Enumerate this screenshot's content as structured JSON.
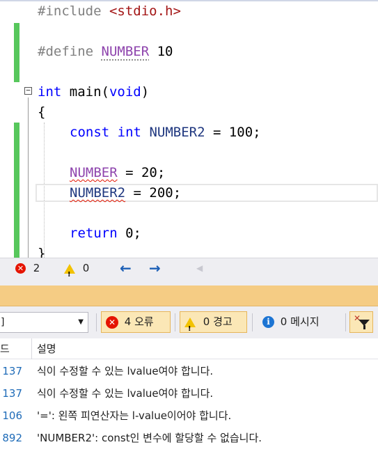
{
  "editor": {
    "lines": [
      {
        "id": "l1",
        "tokens": [
          {
            "t": "#include ",
            "c": "pp"
          },
          {
            "t": "<stdio.h>",
            "c": "str"
          }
        ]
      },
      {
        "id": "l2",
        "tokens": [
          {
            "t": "#define ",
            "c": "pp"
          },
          {
            "t": "NUMBER",
            "c": "mac dots"
          },
          {
            "t": " 10",
            "c": ""
          }
        ]
      },
      {
        "id": "l3",
        "tokens": [
          {
            "t": "int",
            "c": "kw"
          },
          {
            "t": " main(",
            "c": ""
          },
          {
            "t": "void",
            "c": "kw"
          },
          {
            "t": ")",
            "c": ""
          }
        ]
      },
      {
        "id": "l4",
        "tokens": [
          {
            "t": "{",
            "c": ""
          }
        ]
      },
      {
        "id": "l5",
        "tokens": [
          {
            "t": "const",
            "c": "kw"
          },
          {
            "t": " ",
            "c": ""
          },
          {
            "t": "int",
            "c": "kw"
          },
          {
            "t": " ",
            "c": ""
          },
          {
            "t": "NUMBER2",
            "c": "id"
          },
          {
            "t": " = 100;",
            "c": ""
          }
        ]
      },
      {
        "id": "l6",
        "tokens": [
          {
            "t": "NUMBER",
            "c": "mac squig"
          },
          {
            "t": " = 20;",
            "c": ""
          }
        ]
      },
      {
        "id": "l7",
        "tokens": [
          {
            "t": "NUMBER2",
            "c": "id squig"
          },
          {
            "t": " = 200;",
            "c": ""
          }
        ]
      },
      {
        "id": "l8",
        "tokens": [
          {
            "t": "return",
            "c": "kw"
          },
          {
            "t": " 0;",
            "c": ""
          }
        ]
      },
      {
        "id": "l9",
        "tokens": [
          {
            "t": "}",
            "c": ""
          }
        ]
      }
    ],
    "collapse_glyph": "−"
  },
  "status": {
    "errors": "2",
    "warnings": "0",
    "error_glyph": "✕",
    "warn_glyph": "!",
    "back_arrow": "←",
    "forward_arrow": "→",
    "extra_arrow": "◀"
  },
  "error_list": {
    "scope_value": "]",
    "dropdown_glyph": "▼",
    "errors_button": "4 오류",
    "warnings_button": "0 경고",
    "messages_button": "0 메시지",
    "info_glyph": "i",
    "filter_glyph": "✕",
    "columns": {
      "code": "드",
      "description": "설명"
    },
    "rows": [
      {
        "code": "137",
        "description": "식이 수정할 수 있는 lvalue여야 합니다."
      },
      {
        "code": "137",
        "description": "식이 수정할 수 있는 lvalue여야 합니다."
      },
      {
        "code": "106",
        "description": "'=': 왼쪽 피연산자는 l-value이어야 합니다."
      },
      {
        "code": "892",
        "description": "'NUMBER2': const인 변수에 할당할 수 없습니다."
      }
    ]
  },
  "colors": {
    "keyword": "#0000ff",
    "preprocessor": "#808080",
    "string": "#a31515",
    "macro": "#8e44ad",
    "identifier": "#1f377f",
    "error_red": "#e51400",
    "panel_title": "#f5cc84",
    "change_bar": "#57c75c"
  }
}
